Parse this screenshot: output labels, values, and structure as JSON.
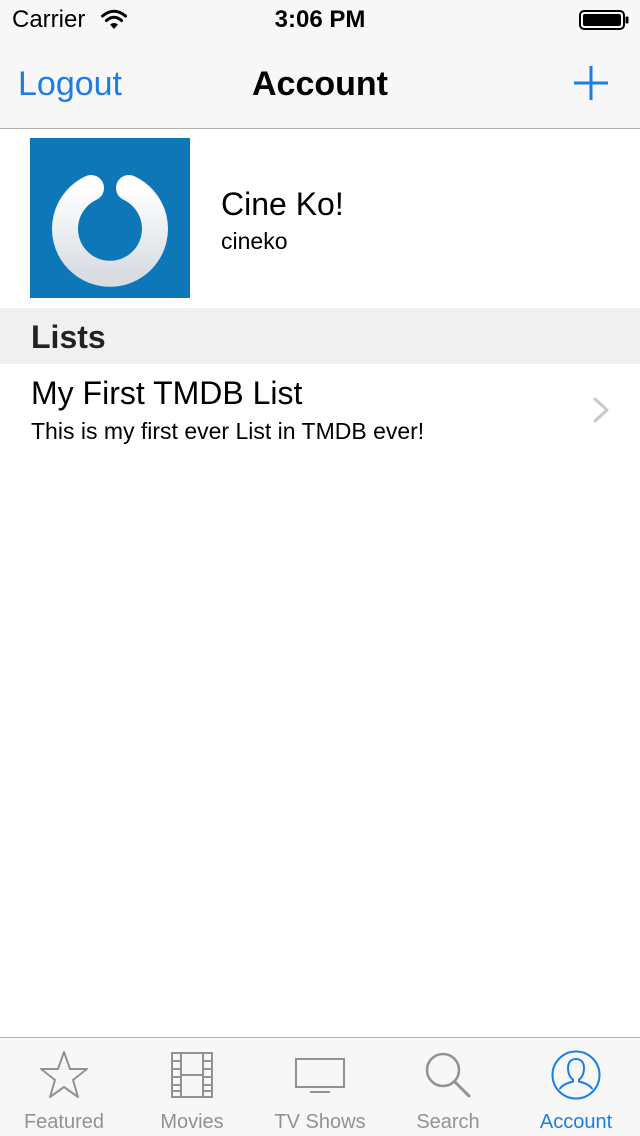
{
  "status_bar": {
    "carrier": "Carrier",
    "time": "3:06 PM"
  },
  "nav": {
    "left_label": "Logout",
    "title": "Account",
    "right_icon": "plus-icon"
  },
  "profile": {
    "name": "Cine Ko!",
    "username": "cineko",
    "avatar_color": "#0d77b8"
  },
  "sections": {
    "lists_header": "Lists"
  },
  "lists": [
    {
      "title": "My First TMDB List",
      "description": "This is my first ever List in TMDB ever!"
    }
  ],
  "tabs": [
    {
      "label": "Featured",
      "icon": "star-icon",
      "active": false
    },
    {
      "label": "Movies",
      "icon": "film-icon",
      "active": false
    },
    {
      "label": "TV Shows",
      "icon": "tv-icon",
      "active": false
    },
    {
      "label": "Search",
      "icon": "search-icon",
      "active": false
    },
    {
      "label": "Account",
      "icon": "person-icon",
      "active": true
    }
  ],
  "colors": {
    "accent": "#1a7ee5",
    "inactive_tab": "#929292",
    "bar_background": "#f7f7f7",
    "section_background": "#f0f0f0"
  }
}
